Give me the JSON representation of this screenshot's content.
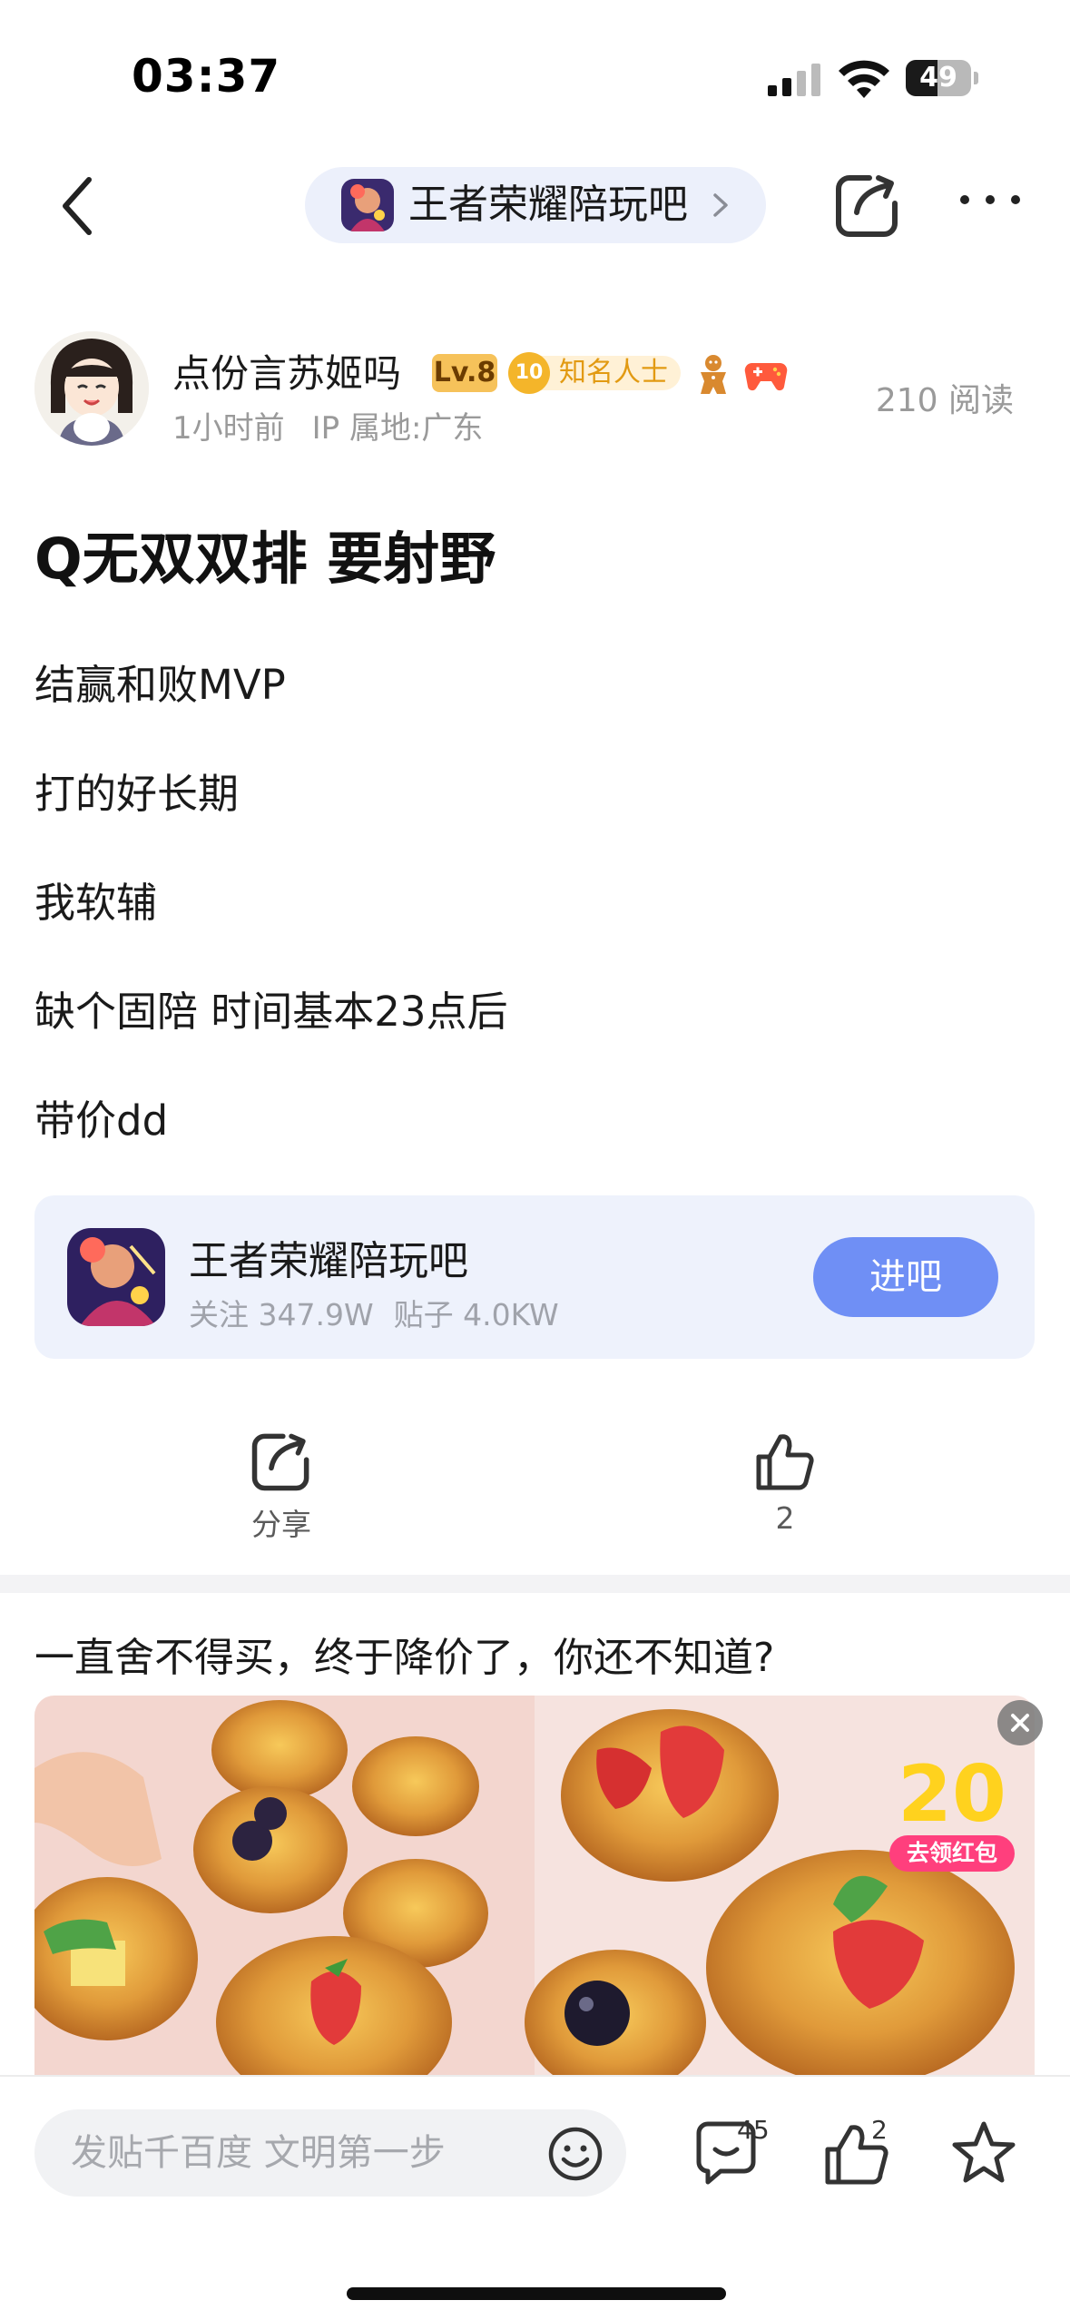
{
  "status_bar": {
    "time": "03:37",
    "battery": "49",
    "battery_level": 0.49
  },
  "nav": {
    "forum_name": "王者荣耀陪玩吧"
  },
  "author": {
    "name": "点份言苏姬吗",
    "level": "Lv.8",
    "fame_level": "10",
    "fame_label": "知名人士",
    "time_ago": "1小时前",
    "ip_location": "IP 属地:广东",
    "read_count": "210 阅读"
  },
  "post": {
    "title": "Q无双双排 要射野",
    "lines": [
      "结赢和败MVP",
      "打的好长期",
      "我软辅",
      "缺个固陪 时间基本23点后",
      "带价dd"
    ]
  },
  "forum_card": {
    "name": "王者荣耀陪玩吧",
    "followers": "关注 347.9W",
    "posts": "贴子 4.0KW",
    "enter_label": "进吧"
  },
  "actions": {
    "share_label": "分享",
    "like_count": "2"
  },
  "ad": {
    "title": "一直舍不得买，终于降价了，你还不知道?",
    "badge_number": "20",
    "badge_label": "去领红包"
  },
  "bottom_bar": {
    "input_placeholder": "发贴千百度 文明第一步",
    "comment_count": "45",
    "like_count": "2"
  },
  "colors": {
    "accent": "#6f8ff5",
    "level_badge": "#f6c25a",
    "fame_badge": "#e29a12",
    "red_packet": "#ff3f7d"
  }
}
